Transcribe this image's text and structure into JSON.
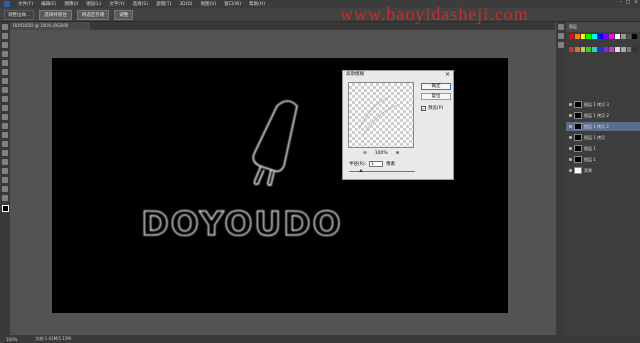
{
  "menubar": {
    "items": [
      "文件(F)",
      "编辑(E)",
      "图像(I)",
      "图层(L)",
      "文字(Y)",
      "选择(S)",
      "滤镜(T)",
      "3D(D)",
      "视图(V)",
      "窗口(W)",
      "帮助(H)"
    ]
  },
  "options": {
    "field": "调整边缘...",
    "btn1": "选择并遮住",
    "btn2": "将选区存储",
    "btn3": "调整"
  },
  "document": {
    "tab_label": "DOYOUDO @ 100% (RGB/8)",
    "canvas_text": "DOYOUDO"
  },
  "watermark": "www.baoyidasheji.com",
  "dialog": {
    "title": "高斯模糊",
    "ok_label": "确定",
    "reset_label": "复位",
    "preview_label": "预览(P)",
    "zoom_value": "100%",
    "radius_label": "半径(R):",
    "radius_value": "1",
    "radius_unit": "像素",
    "minus": "⊖",
    "plus": "⊕",
    "check": "✓"
  },
  "status": {
    "zoom": "100%",
    "doc": "文档:1.03M/5.15M"
  },
  "panel": {
    "header": "图层"
  },
  "layers": [
    {
      "name": "图层 1 拷贝 3"
    },
    {
      "name": "图层 1 拷贝 2"
    },
    {
      "name": "图层 1 拷贝 2",
      "selected": true
    },
    {
      "name": "图层 1 拷贝"
    },
    {
      "name": "图层 1"
    },
    {
      "name": "图层 1"
    },
    {
      "name": "背景"
    }
  ],
  "colors": {
    "watermark": "#e02828",
    "canvas": "#000000",
    "selected_layer": "#5a6e8c"
  }
}
